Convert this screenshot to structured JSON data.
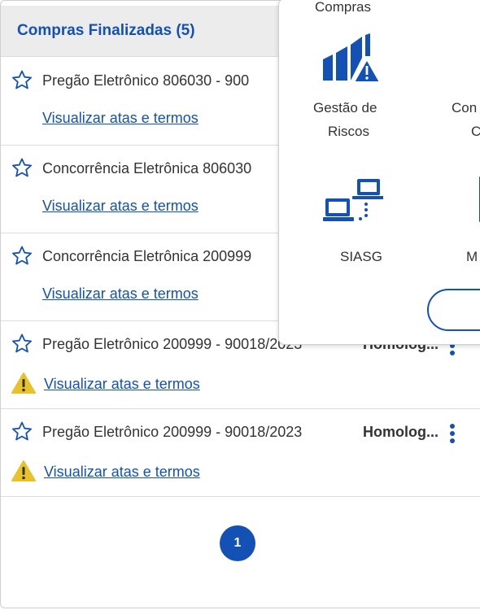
{
  "list": {
    "title": "Compras Finalizadas (5)",
    "rows": [
      {
        "title": "Pregão Eletrônico 806030 - 900",
        "link": "Visualizar atas e termos"
      },
      {
        "title": "Concorrência Eletrônica 806030",
        "link": "Visualizar atas e termos"
      },
      {
        "title": "Concorrência Eletrônica 200999",
        "link": "Visualizar atas e termos"
      },
      {
        "title": "Pregão Eletrônico 200999 - 90018/2023",
        "status": "Homolog...",
        "link": "Visualizar atas e termos"
      },
      {
        "title": "Pregão Eletrônico 200999 - 90018/2023",
        "status": "Homolog...",
        "link": "Visualizar atas e termos"
      }
    ]
  },
  "pagination": {
    "current": "1"
  },
  "menu": {
    "top_label": "Compras",
    "items": [
      {
        "label_line1": "Gestão de",
        "label_line2": "Riscos",
        "icon": "risk-chart-warning-icon"
      },
      {
        "label_line1": "Con",
        "label_line2": "C",
        "icon": "unknown-icon"
      },
      {
        "label": "SIASG",
        "icon": "network-computers-icon"
      },
      {
        "label_line1": "M",
        "label_line2": "",
        "icon": "unknown-icon"
      }
    ]
  },
  "colors": {
    "accent": "#1351b4",
    "warning": "#e8c22a",
    "header_bg": "#ececec"
  }
}
